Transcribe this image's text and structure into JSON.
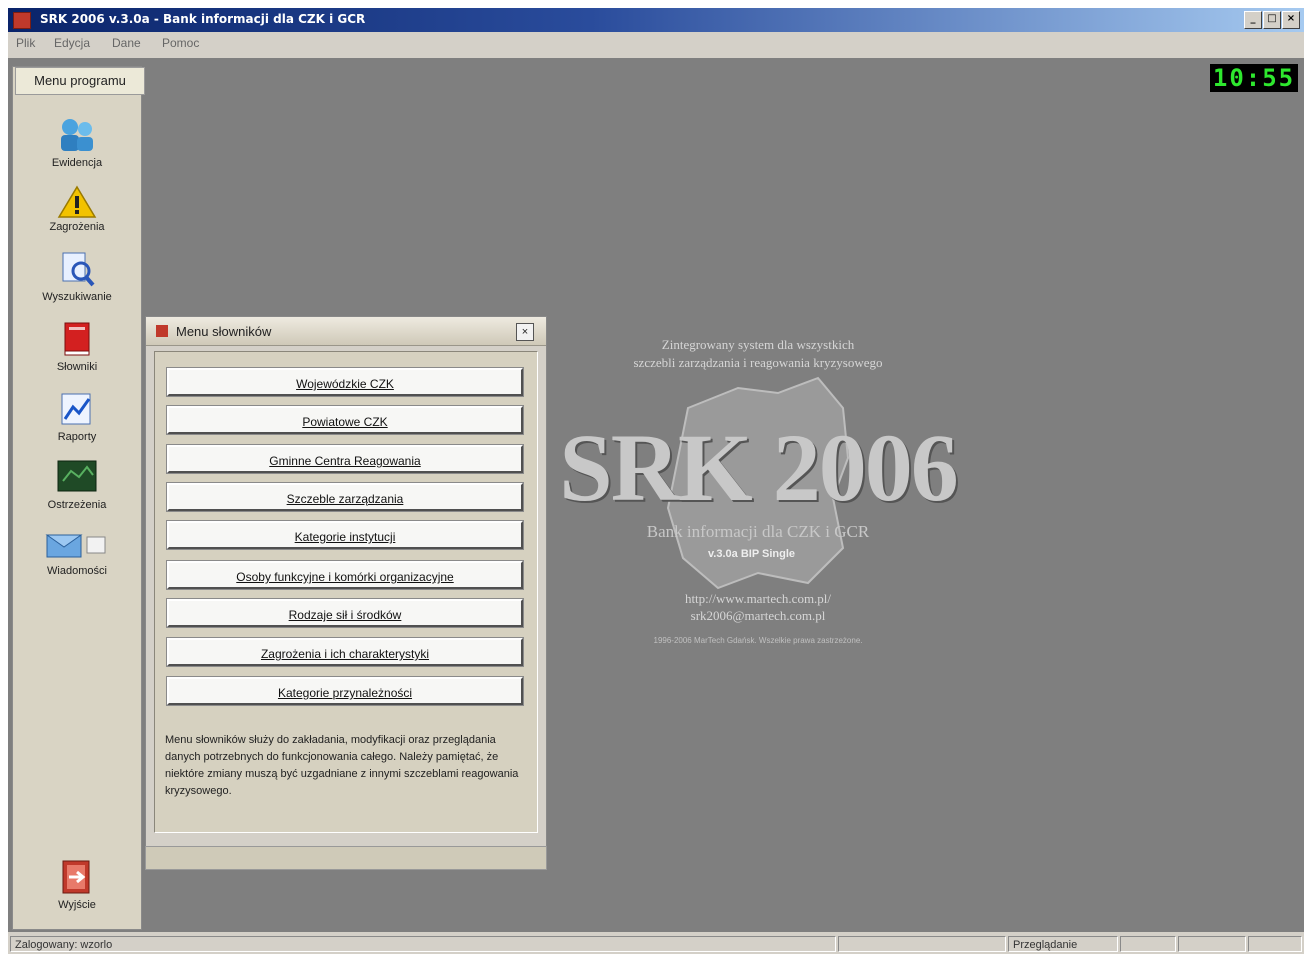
{
  "window": {
    "title": "SRK 2006 v.3.0a - Bank informacji dla CZK i GCR"
  },
  "menubar": {
    "items": [
      "Plik",
      "Edycja",
      "Dane",
      "Pomoc"
    ]
  },
  "clock": {
    "time": "10:55"
  },
  "sidebar": {
    "header": "Menu programu",
    "items": [
      {
        "label": "Ewidencja",
        "icon": "people-icon"
      },
      {
        "label": "Zagrożenia",
        "icon": "warning-icon"
      },
      {
        "label": "Wyszukiwanie",
        "icon": "search-icon"
      },
      {
        "label": "Słowniki",
        "icon": "book-icon"
      },
      {
        "label": "Raporty",
        "icon": "chart-icon"
      },
      {
        "label": "Ostrzeżenia",
        "icon": "map-icon"
      },
      {
        "label": "Wiadomości",
        "icon": "message-icon"
      }
    ],
    "exit_label": "Wyjście"
  },
  "dialog": {
    "title": "Menu słowników",
    "buttons": [
      "Wojewódzkie CZK",
      "Powiatowe CZK",
      "Gminne Centra Reagowania",
      "Szczeble zarządzania",
      "Kategorie instytucji",
      "Osoby funkcyjne i komórki organizacyjne",
      "Rodzaje sił i środków",
      "Zagrożenia i ich charakterystyki",
      "Kategorie przynależności"
    ],
    "description": "Menu słowników służy do zakładania, modyfikacji oraz przeglądania danych potrzebnych do funkcjonowania całego. Należy pamiętać, że niektóre zmiany muszą być uzgadniane z innymi szczeblami reagowania kryzysowego."
  },
  "splash": {
    "tagline1": "Zintegrowany system dla wszystkich",
    "tagline2": "szczebli zarządzania i reagowania kryzysowego",
    "logo": "SRK 2006",
    "subtitle": "Bank informacji dla CZK i GCR",
    "version": "v.3.0a BIP Single",
    "url": "http://www.martech.com.pl/",
    "email": "srk2006@martech.com.pl",
    "copyright": "1996-2006 MarTech Gdańsk. Wszelkie prawa zastrzeżone."
  },
  "statusbar": {
    "left": "Zalogowany: wzorlo",
    "mode": "Przeglądanie"
  },
  "colors": {
    "workspace": "#7f7f7f",
    "titlebar": "#0a246a",
    "clock_text": "#2ee82e"
  }
}
